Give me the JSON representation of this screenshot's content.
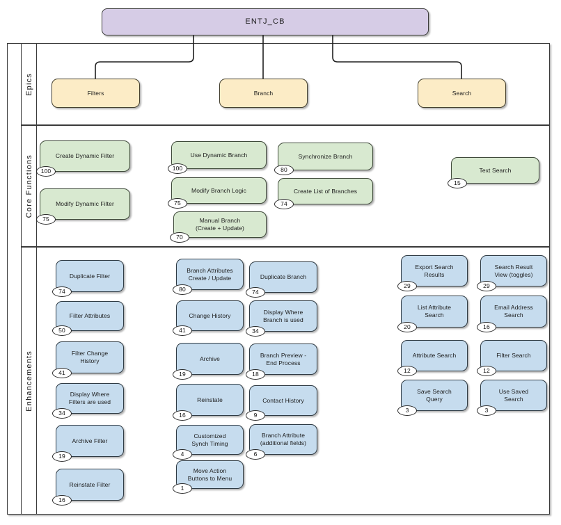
{
  "diagram": {
    "title": "ENTJ_CB",
    "type": "swimlane-hierarchy",
    "colors": {
      "root_fill": "#d6ccE6",
      "epic_fill": "#fcecc6",
      "core_fill": "#d8e9d0",
      "enhancement_fill": "#c6dcee",
      "stroke": "#3a3a3a",
      "badge_fill": "#ffffff"
    }
  },
  "root": {
    "label": "ENTJ_CB"
  },
  "lanes": [
    {
      "id": "epics",
      "label": "Epics"
    },
    {
      "id": "core",
      "label": "Core Functions"
    },
    {
      "id": "enhancements",
      "label": "Enhancements"
    }
  ],
  "epics": [
    {
      "label": "Filters"
    },
    {
      "label": "Branch"
    },
    {
      "label": "Search"
    }
  ],
  "core_functions": [
    {
      "label": "Create Dynamic Filter",
      "count": "100"
    },
    {
      "label": "Modify Dynamic Filter",
      "count": "75"
    },
    {
      "label": "Use Dynamic Branch",
      "count": "100"
    },
    {
      "label": "Modify Branch Logic",
      "count": "75"
    },
    {
      "label": "Manual Branch\n(Create + Update)",
      "count": "70"
    },
    {
      "label": "Synchronize Branch",
      "count": "80"
    },
    {
      "label": "Create List of Branches",
      "count": "74"
    },
    {
      "label": "Text Search",
      "count": "15"
    }
  ],
  "enhancements": {
    "filters_column": [
      {
        "label": "Duplicate Filter",
        "count": "74"
      },
      {
        "label": "Filter Attributes",
        "count": "50"
      },
      {
        "label": "Filter Change\nHistory",
        "count": "41"
      },
      {
        "label": "Display Where\nFilters are used",
        "count": "34"
      },
      {
        "label": "Archive Filter",
        "count": "19"
      },
      {
        "label": "Reinstate Filter",
        "count": "16"
      }
    ],
    "branch_column_a": [
      {
        "label": "Branch Attributes\nCreate / Update",
        "count": "80"
      },
      {
        "label": "Change History",
        "count": "41"
      },
      {
        "label": "Archive",
        "count": "19"
      },
      {
        "label": "Reinstate",
        "count": "16"
      },
      {
        "label": "Customized\nSynch Timing",
        "count": "4"
      },
      {
        "label": "Move Action\nButtons to Menu",
        "count": "1"
      }
    ],
    "branch_column_b": [
      {
        "label": "Duplicate Branch",
        "count": "74"
      },
      {
        "label": "Display Where\nBranch is used",
        "count": "34"
      },
      {
        "label": "Branch Preview -\nEnd Process",
        "count": "18"
      },
      {
        "label": "Contact History",
        "count": "9"
      },
      {
        "label": "Branch Attribute\n(additional fields)",
        "count": "6"
      }
    ],
    "search_column_a": [
      {
        "label": "Export Search\nResults",
        "count": "29"
      },
      {
        "label": "List Attribute\nSearch",
        "count": "20"
      },
      {
        "label": "Attribute Search",
        "count": "12"
      },
      {
        "label": "Save Search\nQuery",
        "count": "3"
      }
    ],
    "search_column_b": [
      {
        "label": "Search Result\nView (toggles)",
        "count": "29"
      },
      {
        "label": "Email Address\nSearch",
        "count": "16"
      },
      {
        "label": "Filter Search",
        "count": "12"
      },
      {
        "label": "Use Saved\nSearch",
        "count": "3"
      }
    ]
  }
}
